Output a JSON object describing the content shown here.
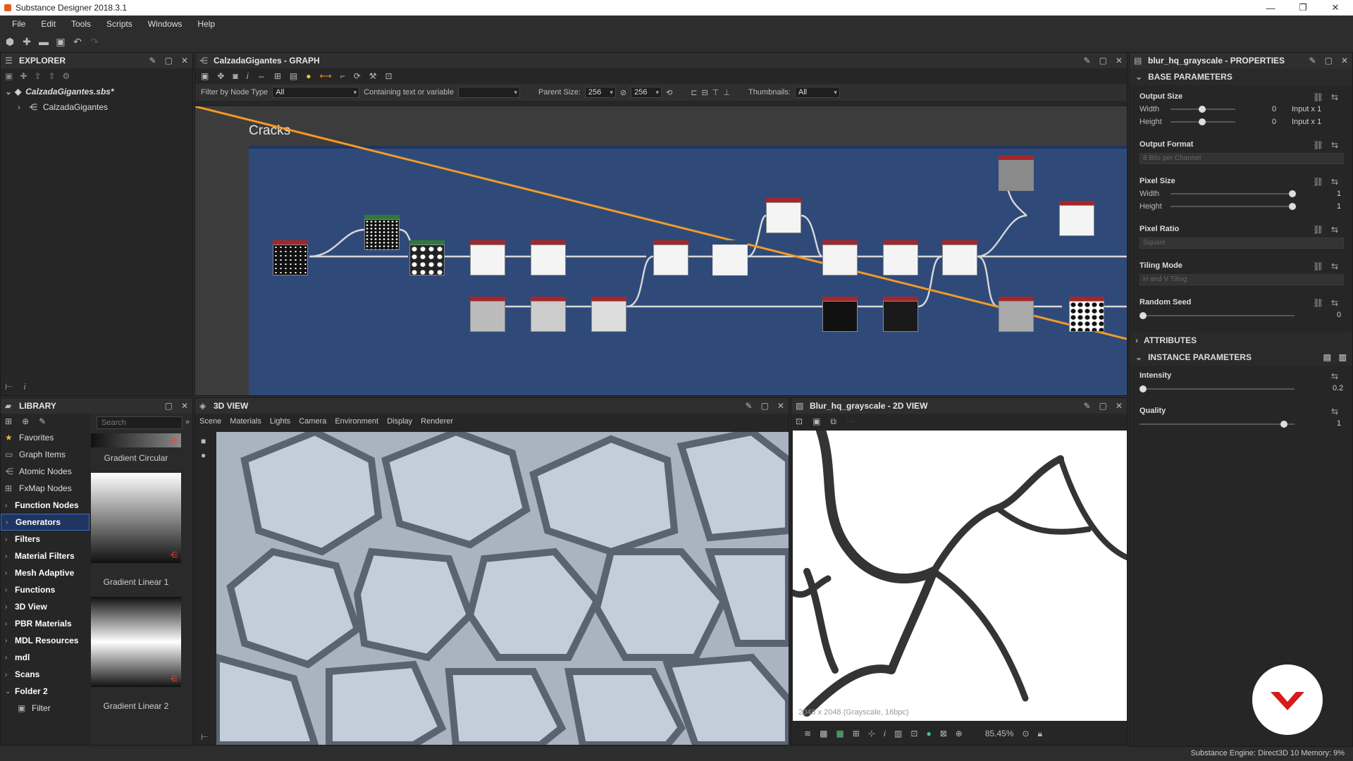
{
  "app": {
    "title": "Substance Designer 2018.3.1"
  },
  "menu": [
    "File",
    "Edit",
    "Tools",
    "Scripts",
    "Windows",
    "Help"
  ],
  "explorer": {
    "title": "EXPLORER",
    "file": "CalzadaGigantes.sbs*",
    "graph": "CalzadaGigantes"
  },
  "graph_panel": {
    "title": "CalzadaGigantes - GRAPH",
    "filter_label": "Filter by Node Type",
    "filter_value": "All",
    "containing_label": "Containing text or variable",
    "containing_value": "",
    "parent_size_label": "Parent Size:",
    "parent_w": "256",
    "parent_h": "256",
    "thumbnails_label": "Thumbnails:",
    "thumbnails_value": "All",
    "frame_title": "Cracks"
  },
  "library": {
    "title": "LIBRARY",
    "search_placeholder": "Search",
    "categories": [
      {
        "label": "Favorites",
        "bold": false
      },
      {
        "label": "Graph Items",
        "bold": false
      },
      {
        "label": "Atomic Nodes",
        "bold": false
      },
      {
        "label": "FxMap Nodes",
        "bold": false
      },
      {
        "label": "Function Nodes",
        "bold": true
      },
      {
        "label": "Generators",
        "bold": true
      },
      {
        "label": "Filters",
        "bold": true
      },
      {
        "label": "Material Filters",
        "bold": true
      },
      {
        "label": "Mesh Adaptive",
        "bold": true
      },
      {
        "label": "Functions",
        "bold": true
      },
      {
        "label": "3D View",
        "bold": true
      },
      {
        "label": "PBR Materials",
        "bold": true
      },
      {
        "label": "MDL Resources",
        "bold": true
      },
      {
        "label": "mdl",
        "bold": true
      },
      {
        "label": "Scans",
        "bold": true
      },
      {
        "label": "Folder 2",
        "bold": true
      },
      {
        "label": "Filter",
        "bold": false
      }
    ],
    "thumbs": [
      "Gradient Circular",
      "Gradient Linear 1",
      "Gradient Linear 2"
    ]
  },
  "view3d": {
    "title": "3D VIEW",
    "menu": [
      "Scene",
      "Materials",
      "Lights",
      "Camera",
      "Environment",
      "Display",
      "Renderer"
    ]
  },
  "view2d": {
    "title": "Blur_hq_grayscale - 2D VIEW",
    "info": "2048 x 2048 (Grayscale, 16bpc)",
    "zoom": "85.45%"
  },
  "props": {
    "title": "blur_hq_grayscale - PROPERTIES",
    "base": "BASE PARAMETERS",
    "attributes": "ATTRIBUTES",
    "instance": "INSTANCE PARAMETERS",
    "output_size": "Output Size",
    "width": "Width",
    "height": "Height",
    "os_w_val": "0",
    "os_h_val": "0",
    "os_w_mode": "Input x 1",
    "os_h_mode": "Input x 1",
    "output_format": "Output Format",
    "output_format_val": "8 Bits per Channel",
    "pixel_size": "Pixel Size",
    "ps_w": "1",
    "ps_h": "1",
    "pixel_ratio": "Pixel Ratio",
    "pixel_ratio_val": "Square",
    "tiling_mode": "Tiling Mode",
    "tiling_val": "H and V Tiling",
    "random_seed": "Random Seed",
    "seed_val": "0",
    "intensity": "Intensity",
    "intensity_val": "0.2",
    "quality": "Quality",
    "quality_val": "1"
  },
  "status": {
    "engine": "Substance Engine: Direct3D 10  Memory: 9%"
  },
  "colors": {
    "accent": "#f39a26",
    "frame": "#2f4a79",
    "node_header": "#a5262a"
  }
}
